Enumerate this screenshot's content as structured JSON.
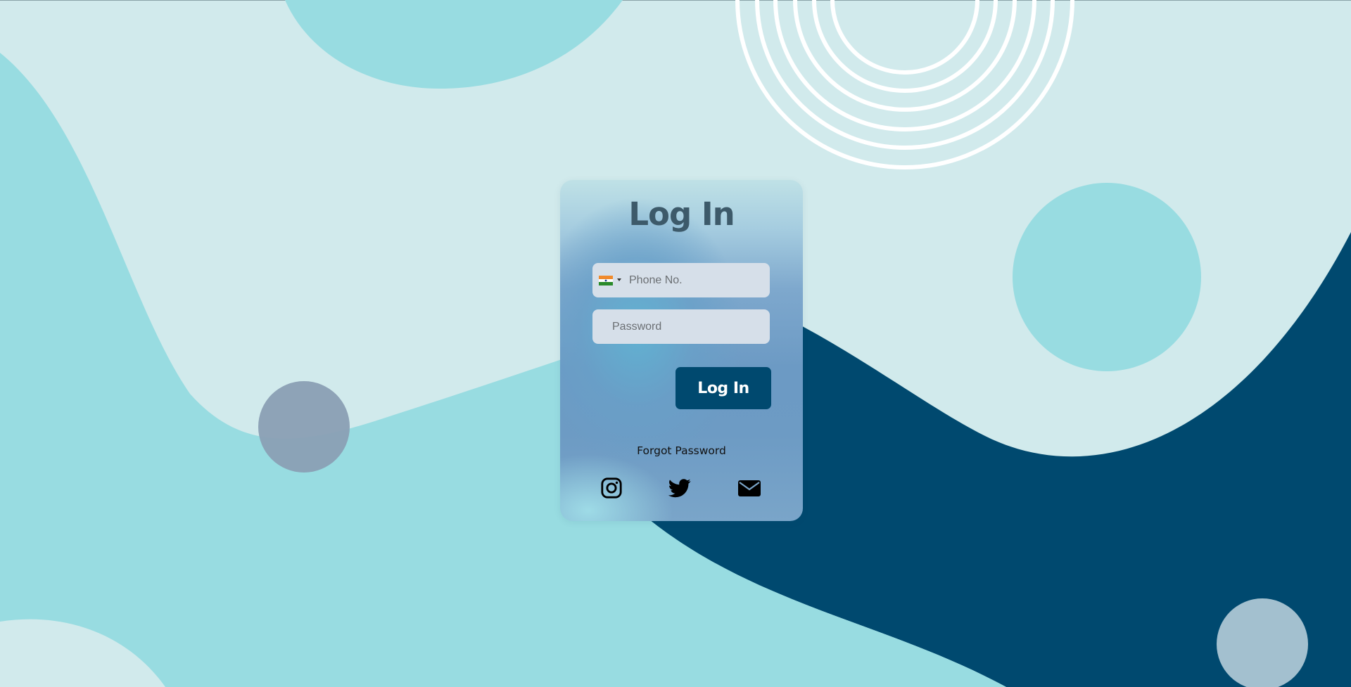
{
  "login": {
    "title": "Log In",
    "phone_placeholder": "Phone No.",
    "password_placeholder": "Password",
    "submit_label": "Log In",
    "forgot_password": "Forgot Password",
    "country_flag": "india-flag-icon"
  },
  "social_links": [
    {
      "icon": "instagram-icon"
    },
    {
      "icon": "twitter-icon"
    },
    {
      "icon": "mail-icon"
    }
  ],
  "colors": {
    "background_light": "#d1eaec",
    "background_teal": "#98dce1",
    "background_navy": "#00496f",
    "button": "#00496f",
    "title_text": "#3d5a6a",
    "input_bg": "#d6dfe9"
  }
}
